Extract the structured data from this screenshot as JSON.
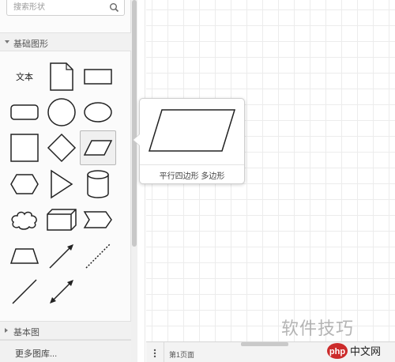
{
  "search": {
    "placeholder": "搜索形状"
  },
  "sections": {
    "basic_shapes": "基础图形",
    "basic_diagram": "基本图"
  },
  "shapes": {
    "text_label": "文本"
  },
  "more_libraries": "更多图库...",
  "preview": {
    "label": "平行四边形 多边形"
  },
  "bottom": {
    "page_tab": "第1页面"
  },
  "watermark": {
    "text": "软件技巧",
    "logo": "php中文网"
  },
  "colors": {
    "php_logo_red": "#cc2b2b",
    "shape_stroke": "#222222"
  }
}
